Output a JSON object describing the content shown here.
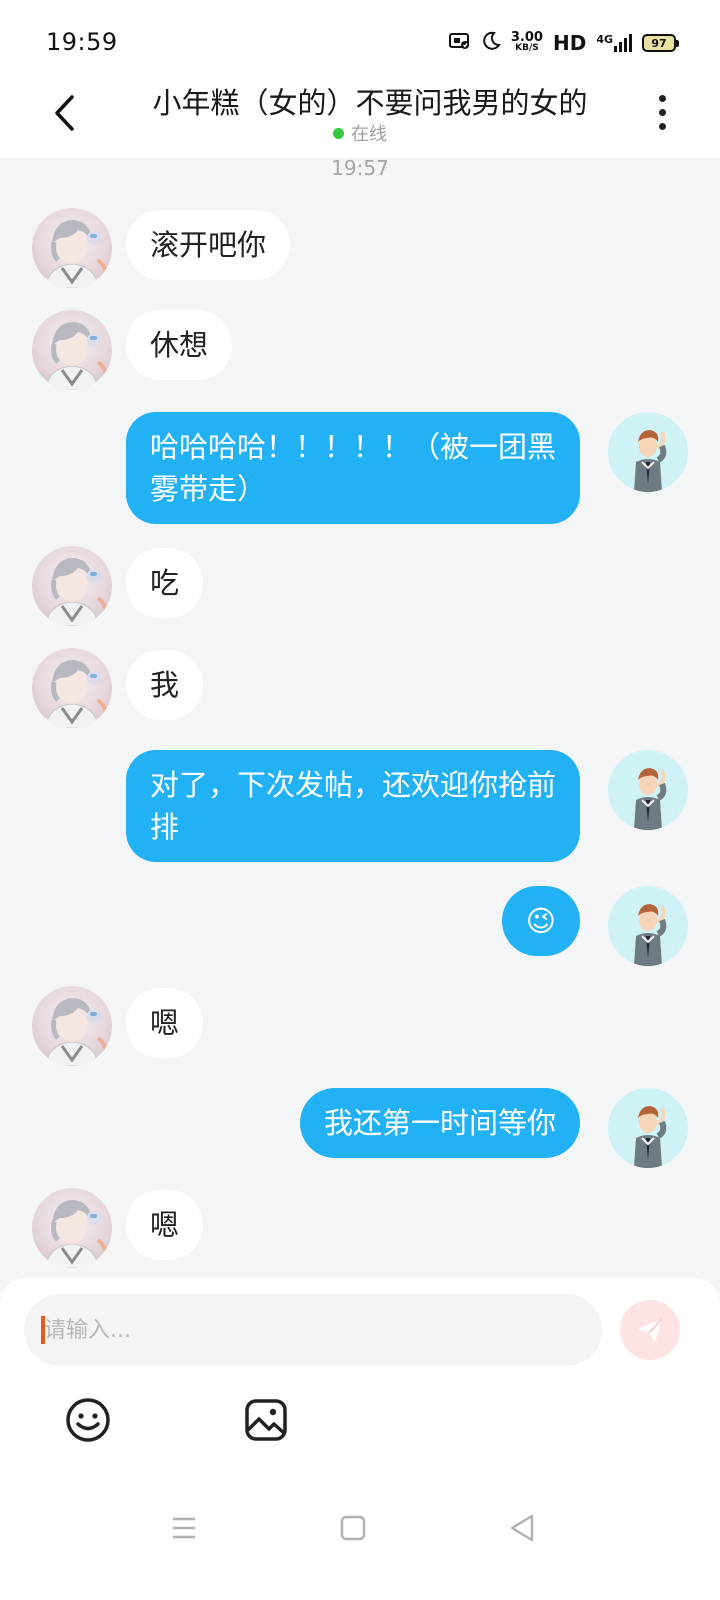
{
  "status_bar": {
    "time": "19:59",
    "net_speed_value": "3.00",
    "net_speed_unit": "KB/S",
    "hd": "HD",
    "network": "4G",
    "battery": "97"
  },
  "header": {
    "title": "小年糕（女的）不要问我男的女的",
    "status": "在线"
  },
  "chat": {
    "timestamp": "19:57",
    "messages": [
      {
        "side": "in",
        "text": "滚开吧你"
      },
      {
        "side": "in",
        "text": "休想"
      },
      {
        "side": "out",
        "text": "哈哈哈哈！！！！！（被一团黑雾带走）"
      },
      {
        "side": "in",
        "text": "吃"
      },
      {
        "side": "in",
        "text": "我"
      },
      {
        "side": "out",
        "text": "对了，下次发帖，还欢迎你抢前排"
      },
      {
        "side": "out",
        "text": "😉"
      },
      {
        "side": "in",
        "text": "嗯"
      },
      {
        "side": "out",
        "text": "我还第一时间等你"
      },
      {
        "side": "in",
        "text": "嗯"
      }
    ]
  },
  "composer": {
    "placeholder": "请输入..."
  },
  "icons": {
    "back": "back-arrow-icon",
    "more": "more-vertical-icon",
    "send": "send-icon",
    "emoji": "smiley-icon",
    "image": "image-icon",
    "nav_menu": "menu-icon",
    "nav_home": "home-square-icon",
    "nav_back": "back-triangle-icon"
  },
  "colors": {
    "outgoing_bubble": "#23b1f5",
    "incoming_bubble": "#ffffff",
    "background": "#f4f5f7",
    "online": "#31c83d",
    "send_button": "#fde3e3"
  }
}
